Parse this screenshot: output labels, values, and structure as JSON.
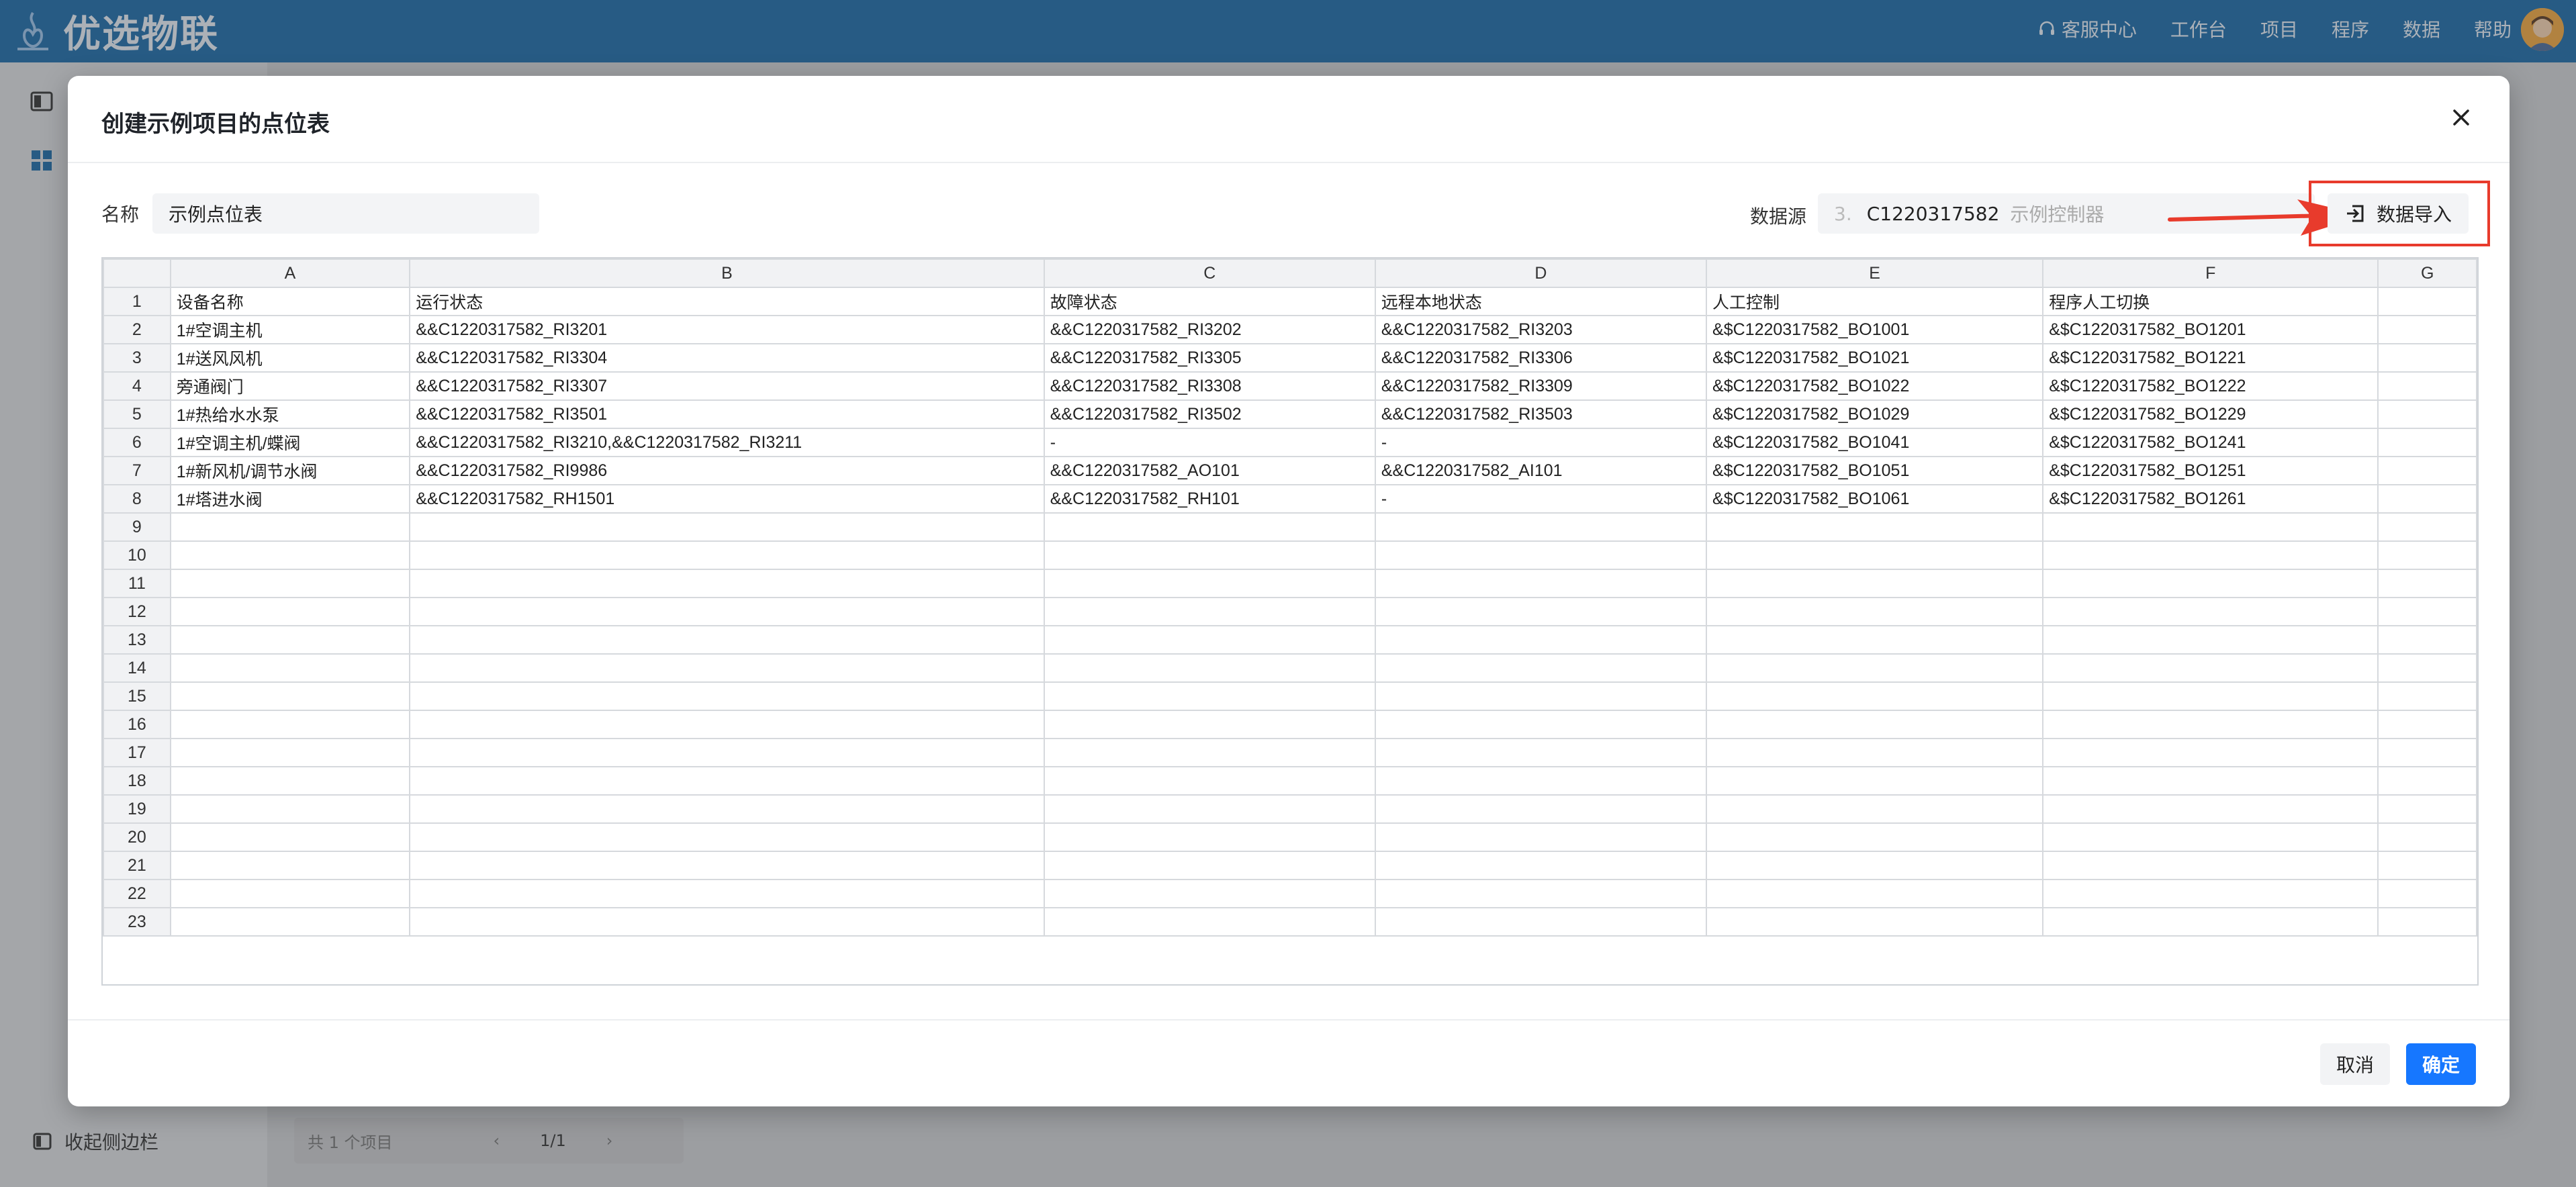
{
  "app": {
    "logo_text": "优选物联"
  },
  "topnav": {
    "items": [
      "客服中心",
      "工作台",
      "项目",
      "程序",
      "数据",
      "帮助"
    ]
  },
  "sidebar": {
    "collapse_label": "收起侧边栏"
  },
  "pager": {
    "total": "共 1 个项目",
    "page": "1/1"
  },
  "modal": {
    "title": "创建示例项目的点位表",
    "name_label": "名称",
    "name_value": "示例点位表",
    "datasource_label": "数据源",
    "datasource_index": "3.",
    "datasource_code": "C1220317582",
    "datasource_name": "示例控制器",
    "import_label": "数据导入",
    "cancel_label": "取消",
    "ok_label": "确定"
  },
  "sheet": {
    "columns": [
      "A",
      "B",
      "C",
      "D",
      "E",
      "F",
      "G"
    ],
    "rows": [
      [
        "设备名称",
        "运行状态",
        "故障状态",
        "远程本地状态",
        "人工控制",
        "程序人工切换",
        ""
      ],
      [
        "1#空调主机",
        "&&C1220317582_RI3201",
        "&&C1220317582_RI3202",
        "&&C1220317582_RI3203",
        "&$C1220317582_BO1001",
        "&$C1220317582_BO1201",
        ""
      ],
      [
        "1#送风风机",
        "&&C1220317582_RI3304",
        "&&C1220317582_RI3305",
        "&&C1220317582_RI3306",
        "&$C1220317582_BO1021",
        "&$C1220317582_BO1221",
        ""
      ],
      [
        "旁通阀门",
        "&&C1220317582_RI3307",
        "&&C1220317582_RI3308",
        "&&C1220317582_RI3309",
        "&$C1220317582_BO1022",
        "&$C1220317582_BO1222",
        ""
      ],
      [
        "1#热给水水泵",
        "&&C1220317582_RI3501",
        "&&C1220317582_RI3502",
        "&&C1220317582_RI3503",
        "&$C1220317582_BO1029",
        "&$C1220317582_BO1229",
        ""
      ],
      [
        "1#空调主机/蝶阀",
        "&&C1220317582_RI3210,&&C1220317582_RI3211",
        "-",
        "-",
        "&$C1220317582_BO1041",
        "&$C1220317582_BO1241",
        ""
      ],
      [
        "1#新风机/调节水阀",
        "&&C1220317582_RI9986",
        "&&C1220317582_AO101",
        "&&C1220317582_AI101",
        "&$C1220317582_BO1051",
        "&$C1220317582_BO1251",
        ""
      ],
      [
        "1#塔进水阀",
        "&&C1220317582_RH1501",
        "&&C1220317582_RH101",
        "-",
        "&$C1220317582_BO1061",
        "&$C1220317582_BO1261",
        ""
      ]
    ],
    "row_count": 23
  },
  "colors": {
    "topbar": "#1d6aa8",
    "primary": "#1677ff",
    "highlight": "#e83b2c"
  }
}
